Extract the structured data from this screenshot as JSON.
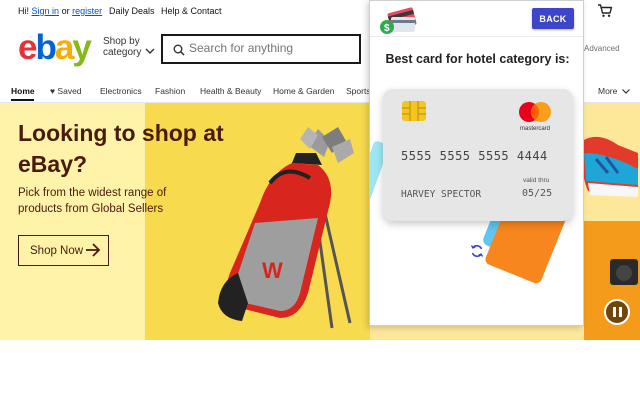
{
  "topbar": {
    "greeting": "Hi!",
    "sign_in": "Sign in",
    "or": "or",
    "register": "register",
    "daily_deals": "Daily Deals",
    "help_contact": "Help & Contact",
    "cart_icon": "cart-icon"
  },
  "header": {
    "logo": {
      "e": "e",
      "b": "b",
      "a": "a",
      "y": "y"
    },
    "shop_by_line1": "Shop by",
    "shop_by_line2": "category",
    "search_placeholder": "Search for anything",
    "advanced": "Advanced"
  },
  "nav": {
    "home": "Home",
    "saved": "Saved",
    "electronics": "Electronics",
    "fashion": "Fashion",
    "health_beauty": "Health & Beauty",
    "home_garden": "Home & Garden",
    "sports": "Sports",
    "more": "More"
  },
  "hero": {
    "title": "Looking to shop at eBay?",
    "subtitle": "Pick from the widest range of products from Global Sellers",
    "button": "Shop Now",
    "bag_brand": "W"
  },
  "popup": {
    "back_label": "BACK",
    "heading": "Best card for hotel category is:",
    "card": {
      "network": "mastercard",
      "number": "5555 5555 5555 4444",
      "holder": "HARVEY SPECTOR",
      "valid_thru_label": "valid thru",
      "expiry": "05/25"
    }
  },
  "colors": {
    "accent": "#3f45c8",
    "hero_text": "#4a1a0c",
    "hero_yellow": "#f8da4e",
    "ebay_red": "#e53238",
    "ebay_blue": "#0064d2",
    "ebay_yellow": "#f5af02",
    "ebay_green": "#86b817"
  }
}
